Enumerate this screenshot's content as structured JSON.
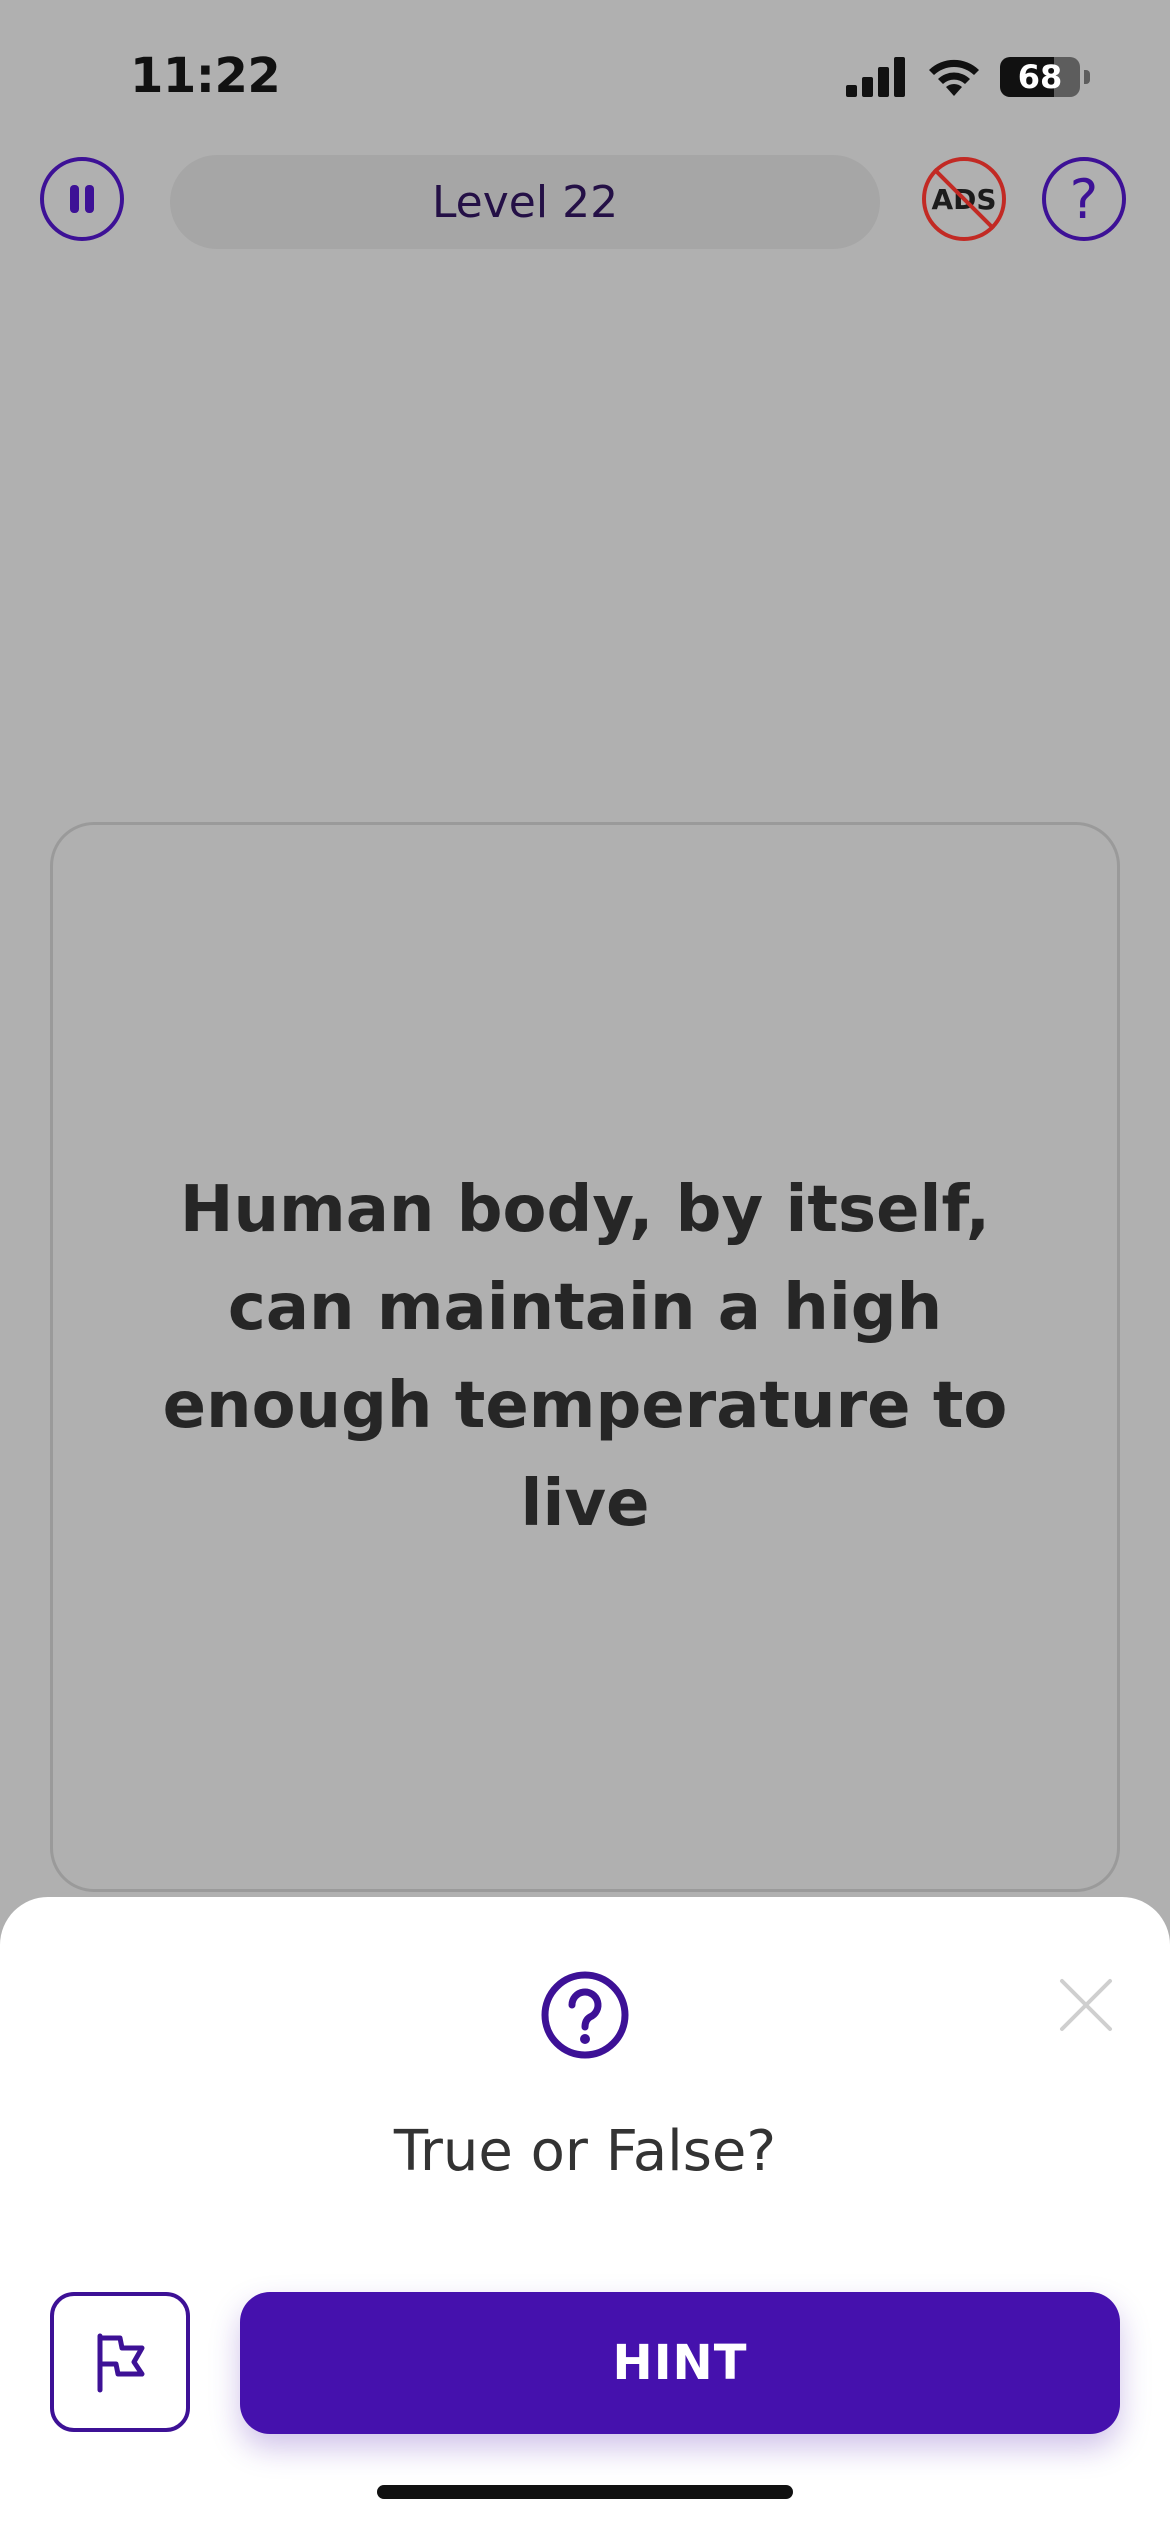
{
  "status_bar": {
    "time": "11:22",
    "battery_percent": "68",
    "battery_level": 0.68
  },
  "top_bar": {
    "level_label": "Level 22",
    "no_ads_label": "ADS",
    "help_symbol": "?"
  },
  "question": {
    "text": "Human body, by itself, can maintain a high enough temperature to live"
  },
  "sheet": {
    "title": "True or False?",
    "hint_label": "HINT"
  },
  "colors": {
    "accent": "#4511ad",
    "accent_outline": "#3d1196",
    "no_ads_red": "#c22a24",
    "overlay_bg": "#b0b0b0"
  },
  "icons": {
    "pause": "pause-icon",
    "no_ads": "no-ads-icon",
    "help": "question-circle-icon",
    "sheet_icon": "question-circle-icon",
    "close": "close-icon",
    "flag": "flag-icon"
  }
}
